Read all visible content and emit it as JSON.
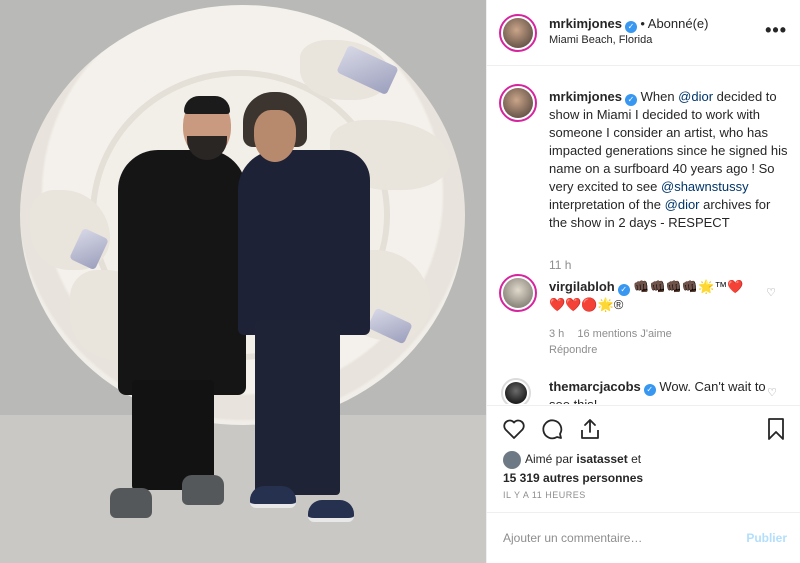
{
  "post": {
    "author": "mrkimjones",
    "follow_state": "• Abonné(e)",
    "location": "Miami Beach, Florida",
    "more_icon": "more-icon",
    "caption": {
      "author": "mrkimjones",
      "part1": " When ",
      "mention1": "@dior",
      "part2": " decided to show in Miami I decided to work with someone I consider an artist, who has impacted generations since he signed his name on a surfboard 40 years ago ! So very excited to see ",
      "mention2": "@shawnstussy",
      "part3": " interpretation of the ",
      "mention3": "@dior",
      "part4": " archives for the show in 2 days - RESPECT"
    },
    "caption_time": "11 h"
  },
  "comments": [
    {
      "author": "virgilabloh",
      "text_line1": "👊🏿👊🏿👊🏿👊🏿🌟™❤️",
      "text_line2": "❤️❤️🔴🌟®",
      "time": "3 h",
      "likes": "16 mentions J'aime",
      "reply": "Répondre"
    },
    {
      "author": "themarcjacobs",
      "text": " Wow. Can't wait to see this!"
    }
  ],
  "likes": {
    "prefix": "Aimé par ",
    "first": "isatasset",
    "mid": " et",
    "count": "15 319 autres personnes"
  },
  "posted_ago": "IL Y A 11 HEURES",
  "add_comment": {
    "placeholder": "Ajouter un commentaire…",
    "publish": "Publier"
  },
  "colors": {
    "link": "#003569",
    "verified": "#3897f0",
    "muted": "#8e8e8e",
    "publish_disabled": "#b2dffc"
  }
}
